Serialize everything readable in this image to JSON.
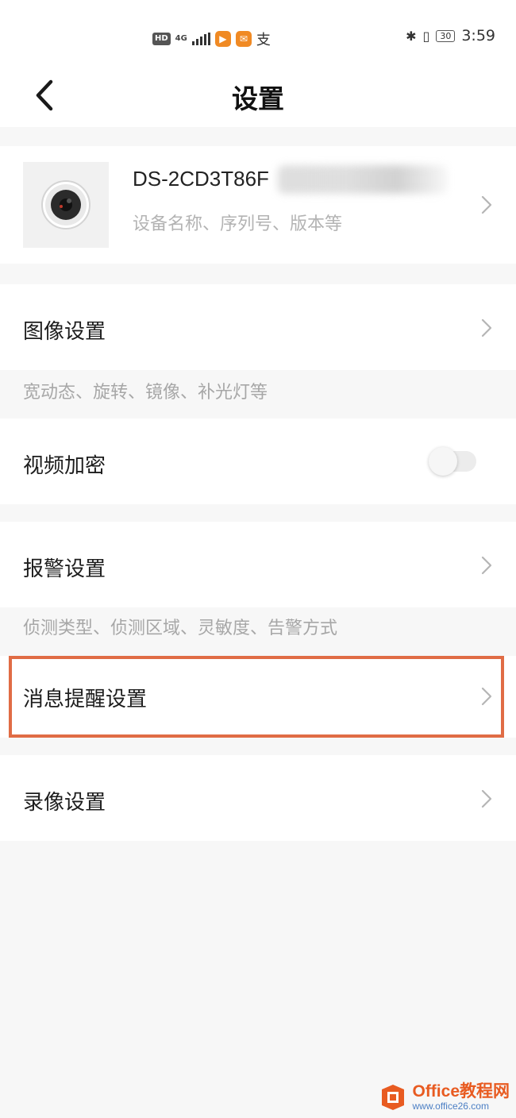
{
  "status_bar": {
    "hd": "HD",
    "network": "4G",
    "time": "3:59",
    "battery": "30"
  },
  "header": {
    "title": "设置"
  },
  "device": {
    "name": "DS-2CD3T86F",
    "subtitle": "设备名称、序列号、版本等"
  },
  "settings": {
    "image": {
      "label": "图像设置",
      "desc": "宽动态、旋转、镜像、补光灯等"
    },
    "video_encryption": {
      "label": "视频加密",
      "enabled": false
    },
    "alarm": {
      "label": "报警设置",
      "desc": "侦测类型、侦测区域、灵敏度、告警方式"
    },
    "message_reminder": {
      "label": "消息提醒设置"
    },
    "recording": {
      "label": "录像设置"
    }
  },
  "watermark": {
    "brand": "Office教程网",
    "url": "www.office26.com"
  },
  "colors": {
    "highlight": "#e06c45",
    "background": "#f7f7f7",
    "chevron": "#b5b5b5"
  }
}
